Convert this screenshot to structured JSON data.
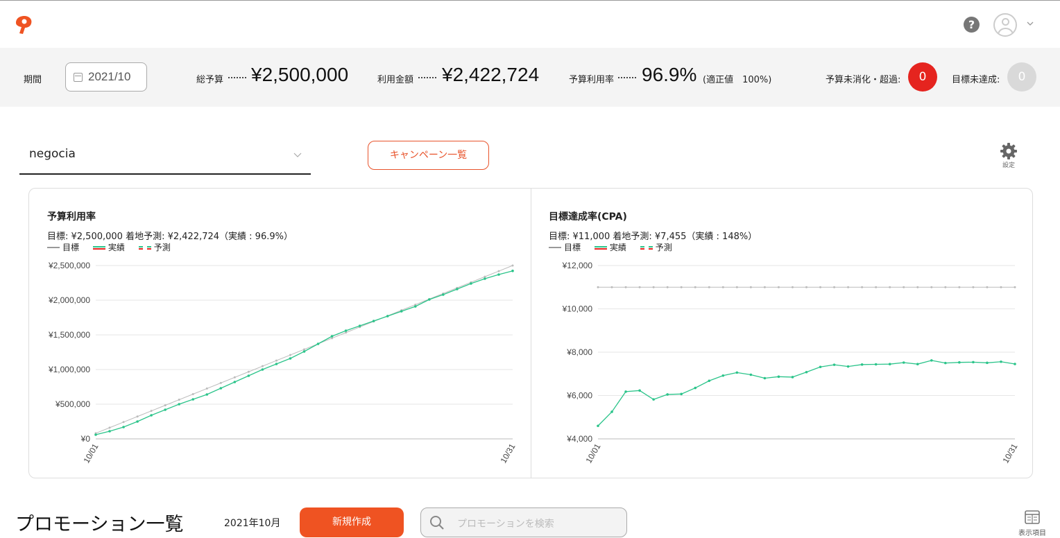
{
  "header": {
    "logo_icon": "brand-logo-icon",
    "help_icon": "question-circle-icon",
    "help_label": "?",
    "avatar_icon": "user-avatar-icon",
    "menu_icon": "chevron-down-icon"
  },
  "summary": {
    "period_label": "期間",
    "period_value": "2021/10",
    "total_budget_label": "総予算",
    "total_budget_value": "¥2,500,000",
    "spent_label": "利用金額",
    "spent_value": "¥2,422,724",
    "usage_rate_label": "予算利用率",
    "usage_rate_value": "96.9%",
    "usage_rate_note": "(適正値　100%)",
    "unspent_label": "予算未消化・超過:",
    "unspent_count": "0",
    "target_unmet_label": "目標未達成:",
    "target_unmet_count": "0"
  },
  "controls": {
    "account_value": "negocia",
    "campaign_list_label": "キャンペーン一覧",
    "settings_label": "設定"
  },
  "legend": {
    "target": "目標",
    "actual": "実績",
    "forecast": "予測"
  },
  "chart_data": [
    {
      "type": "line",
      "title": "予算利用率",
      "subtitle": "目標: ¥2,500,000  着地予測: ¥2,422,724（実績 : 96.9%）",
      "x_labels": [
        "10/01",
        "10/31"
      ],
      "ylim": [
        0,
        2500000
      ],
      "y_ticks": [
        "¥0",
        "¥500,000",
        "¥1,000,000",
        "¥1,500,000",
        "¥2,000,000",
        "¥2,500,000"
      ],
      "grid": true,
      "colors": {
        "target": "#bbbbbb",
        "actual": "#2bc48a"
      },
      "series": [
        {
          "name": "目標",
          "values": [
            80645,
            161290,
            241935,
            322581,
            403226,
            483871,
            564516,
            645161,
            725806,
            806452,
            887097,
            967742,
            1048387,
            1129032,
            1209677,
            1290323,
            1370968,
            1451613,
            1532258,
            1612903,
            1693548,
            1774194,
            1854839,
            1935484,
            2016129,
            2096774,
            2177419,
            2258065,
            2338710,
            2419355,
            2500000
          ]
        },
        {
          "name": "実績",
          "values": [
            60000,
            110000,
            170000,
            250000,
            340000,
            420000,
            500000,
            570000,
            640000,
            730000,
            820000,
            910000,
            1000000,
            1080000,
            1160000,
            1260000,
            1370000,
            1480000,
            1560000,
            1630000,
            1700000,
            1770000,
            1840000,
            1910000,
            2010000,
            2080000,
            2160000,
            2240000,
            2310000,
            2370000,
            2422724
          ]
        }
      ]
    },
    {
      "type": "line",
      "title": "目標達成率(CPA)",
      "subtitle": "目標: ¥11,000  着地予測: ¥7,455（実績 : 148%）",
      "x_labels": [
        "10/01",
        "10/31"
      ],
      "ylim": [
        4000,
        12000
      ],
      "y_ticks": [
        "¥4,000",
        "¥6,000",
        "¥8,000",
        "¥10,000",
        "¥12,000"
      ],
      "grid": true,
      "colors": {
        "target": "#bbbbbb",
        "actual": "#2bc48a"
      },
      "series": [
        {
          "name": "目標",
          "values": [
            11000,
            11000,
            11000,
            11000,
            11000,
            11000,
            11000,
            11000,
            11000,
            11000,
            11000,
            11000,
            11000,
            11000,
            11000,
            11000,
            11000,
            11000,
            11000,
            11000,
            11000,
            11000,
            11000,
            11000,
            11000,
            11000,
            11000,
            11000,
            11000,
            11000,
            11000
          ]
        },
        {
          "name": "実績",
          "values": [
            4600,
            5250,
            6180,
            6230,
            5820,
            6050,
            6070,
            6350,
            6680,
            6920,
            7060,
            6960,
            6800,
            6870,
            6850,
            7080,
            7320,
            7420,
            7340,
            7430,
            7440,
            7450,
            7520,
            7450,
            7620,
            7500,
            7530,
            7540,
            7510,
            7560,
            7455
          ]
        }
      ]
    }
  ],
  "promotions": {
    "title": "プロモーション一覧",
    "date": "2021年10月",
    "new_button": "新規作成",
    "search_placeholder": "プロモーションを検索",
    "display_items_label": "表示項目"
  }
}
